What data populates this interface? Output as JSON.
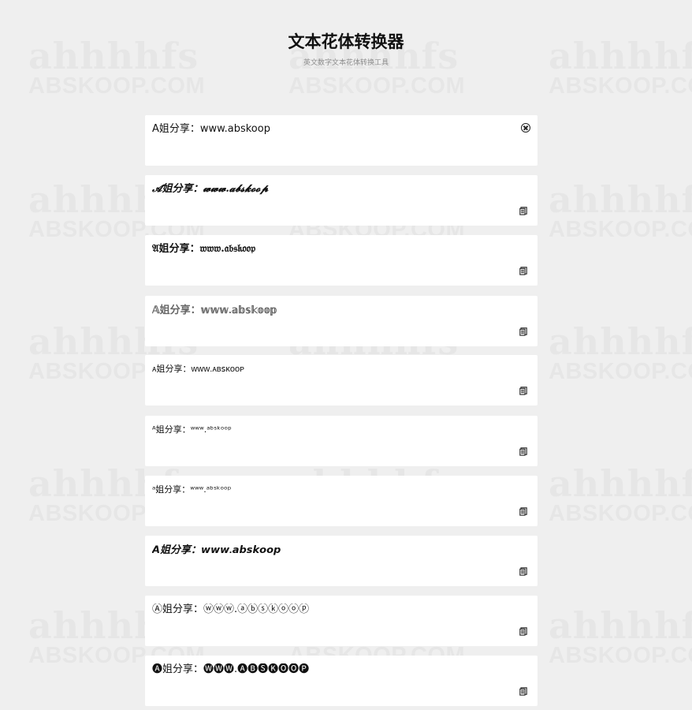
{
  "header": {
    "title": "文本花体转换器",
    "subtitle": "英文数字文本花体转换工具"
  },
  "input": {
    "value": "A姐分享：www.abskoop",
    "placeholder": "",
    "clear_icon": "circle-x-icon"
  },
  "results": [
    {
      "text": "𝓐姐分享：𝔀𝔀𝔀.𝓪𝓫𝓼𝓴𝓸𝓸𝓹",
      "copy_icon": "copy-icon"
    },
    {
      "text": "𝔄姐分享：𝔴𝔴𝔴.𝔞𝔟𝔰𝔨𝔬𝔬𝔭",
      "copy_icon": "copy-icon"
    },
    {
      "text": "𝔸姐分享：𝕨𝕨𝕨.𝕒𝕓𝕤𝕜𝕠𝕠𝕡",
      "copy_icon": "copy-icon"
    },
    {
      "text": "ᴀ姐分享：ᴡᴡᴡ.ᴀʙꜱᴋᴏᴏᴘ",
      "copy_icon": "copy-icon"
    },
    {
      "text": "ᴬ姐分享：ʷʷʷ.ᵃᵇˢᵏᵒᵒᵖ",
      "copy_icon": "copy-icon"
    },
    {
      "text": "ᵃ姐分享：ʷʷʷ.ᵃᵇˢᵏᵒᵒᵖ",
      "copy_icon": "copy-icon"
    },
    {
      "text": "𝘼姐分享：𝙬𝙬𝙬.𝙖𝙗𝙨𝙠𝙤𝙤𝙥",
      "copy_icon": "copy-icon"
    },
    {
      "text": "Ⓐ姐分享：ⓦⓦⓦ.ⓐⓑⓢⓚⓞⓞⓟ",
      "copy_icon": "copy-icon"
    },
    {
      "text": "🅐姐分享：🅦🅦🅦.🅐🅑🅢🅚🅞🅞🅟",
      "copy_icon": "copy-icon"
    }
  ],
  "watermark": {
    "top_text": "ahhhhfs",
    "bottom_text": "ABSKOOP.COM"
  }
}
